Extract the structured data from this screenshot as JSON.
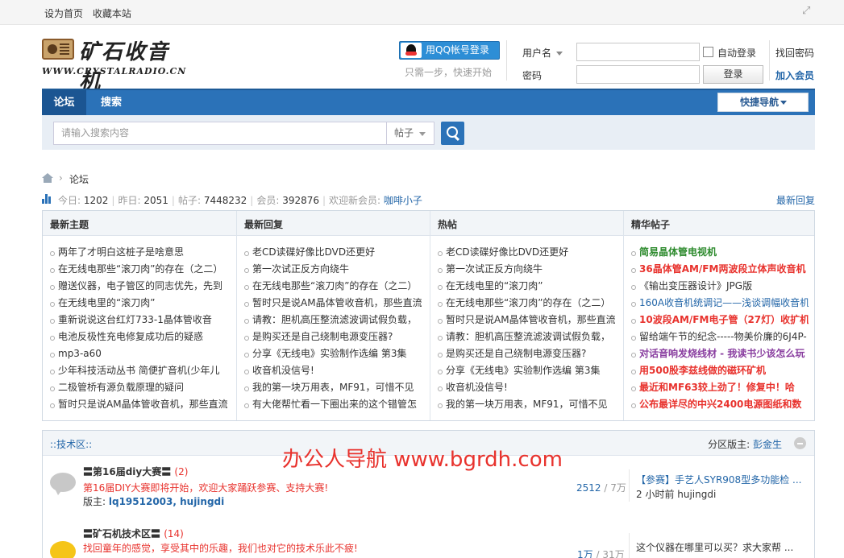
{
  "topbar": {
    "set_home": "设为首页",
    "bookmark": "收藏本站"
  },
  "logo": {
    "cn": "矿石收音机",
    "en": "WWW.CRYSTALRADIO.CN"
  },
  "qq": {
    "button": "用QQ帐号登录",
    "hint": "只需一步，快速开始"
  },
  "login": {
    "username_label": "用户名",
    "password_label": "密码",
    "auto_login": "自动登录",
    "login_button": "登录",
    "find_password": "找回密码",
    "register": "加入会员"
  },
  "nav": {
    "tabs": [
      "论坛",
      "搜索"
    ],
    "quick_nav": "快捷导航"
  },
  "search": {
    "placeholder": "请输入搜索内容",
    "type": "帖子"
  },
  "breadcrumb": {
    "current": "论坛"
  },
  "stats": {
    "today_label": "今日:",
    "today": "1202",
    "yesterday_label": "昨日:",
    "yesterday": "2051",
    "posts_label": "帖子:",
    "posts": "7448232",
    "members_label": "会员:",
    "members": "392876",
    "welcome_label": "欢迎新会员:",
    "new_member": "咖啡小子",
    "latest_reply": "最新回复"
  },
  "portal": {
    "columns": [
      {
        "title": "最新主题",
        "items": [
          "两年了才明白这桩子是啥意思",
          "在无线电那些“滚刀肉”的存在（之二）",
          "赠送仪器，电子管区的同志优先，先到",
          "在无线电里的“滚刀肉”",
          "重新说说这台红灯733-1晶体管收音",
          "电池反极性充电修复成功后的疑惑",
          "mp3-a60",
          "少年科技活动丛书 简便扩音机(少年儿",
          "二极管桥有源负载原理的疑问",
          "暂时只是说AM晶体管收音机，那些直流"
        ]
      },
      {
        "title": "最新回复",
        "items": [
          "老CD读碟好像比DVD还更好",
          "第一次试正反方向绕牛",
          "在无线电那些“滚刀肉”的存在（之二）",
          "暂时只是说AM晶体管收音机，那些直流",
          "请教：胆机高压整流滤波调试假负载，",
          "是购买还是自己绕制电源变压器?",
          "分享《无线电》实验制作选编 第3集",
          "收音机没信号!",
          "我的第一块万用表，MF91，可惜不见",
          "有大佬帮忙看一下圈出来的这个错管怎"
        ]
      },
      {
        "title": "热帖",
        "items": [
          "老CD读碟好像比DVD还更好",
          "第一次试正反方向绕牛",
          "在无线电里的“滚刀肉”",
          "在无线电那些“滚刀肉”的存在（之二）",
          "暂时只是说AM晶体管收音机，那些直流",
          "请教：胆机高压整流滤波调试假负载，",
          "是购买还是自己绕制电源变压器?",
          "分享《无线电》实验制作选编 第3集",
          "收音机没信号!",
          "我的第一块万用表，MF91，可惜不见"
        ]
      },
      {
        "title": "精华帖子",
        "items": [
          {
            "text": "简易晶体管电视机",
            "color": "#2e8b2e"
          },
          {
            "text": "36晶体管AM/FM两波段立体声收音机",
            "color": "#e8322d"
          },
          {
            "text": "《输出变压器设计》JPG版",
            "color": "#333333",
            "normal": true
          },
          {
            "text": "160A收音机统调记——浅谈调幅收音机",
            "color": "#2366a8",
            "normal": true
          },
          {
            "text": "10波段AM/FM电子管（27灯）收扩机",
            "color": "#e8322d"
          },
          {
            "text": "留给端午节的纪念-----物美价廉的6J4P-",
            "color": "#333333",
            "normal": true
          },
          {
            "text": "对话音响发烧线材 - 我读书少该怎么玩",
            "color": "#8a3fa0"
          },
          {
            "text": "用500股李兹线做的磁环矿机",
            "color": "#e8322d"
          },
          {
            "text": "最近和MF63较上劲了！修复中！哈",
            "color": "#e8322d"
          },
          {
            "text": "公布最详尽的中兴2400电源图纸和数",
            "color": "#e8322d"
          }
        ]
      }
    ]
  },
  "zone": {
    "title": "::技术区::",
    "moderator_label": "分区版主:",
    "moderator": "彭金生",
    "forums": [
      {
        "name": "〓第16届diy大赛〓",
        "count": "(2)",
        "desc": "第16届DIY大赛即将开始，欢迎大家踊跃参赛、支持大赛!",
        "mods_label": "版主:",
        "mods": "lq19512003, hujingdi",
        "threads": "2512",
        "posts": "7万",
        "last_title": "【参赛】手艺人SYR908型多功能检 ...",
        "last_meta": "2 小时前 hujingdi"
      },
      {
        "name": "〓矿石机技术区〓",
        "count": "(14)",
        "desc": "找回童年的感觉，享受其中的乐趣，我们也对它的技术乐此不疲!",
        "threads": "1万",
        "posts": "31万",
        "last_title": "这个仪器在哪里可以买？求大家帮 ..."
      }
    ]
  },
  "watermark": "办公人导航  www.bgrdh.com"
}
